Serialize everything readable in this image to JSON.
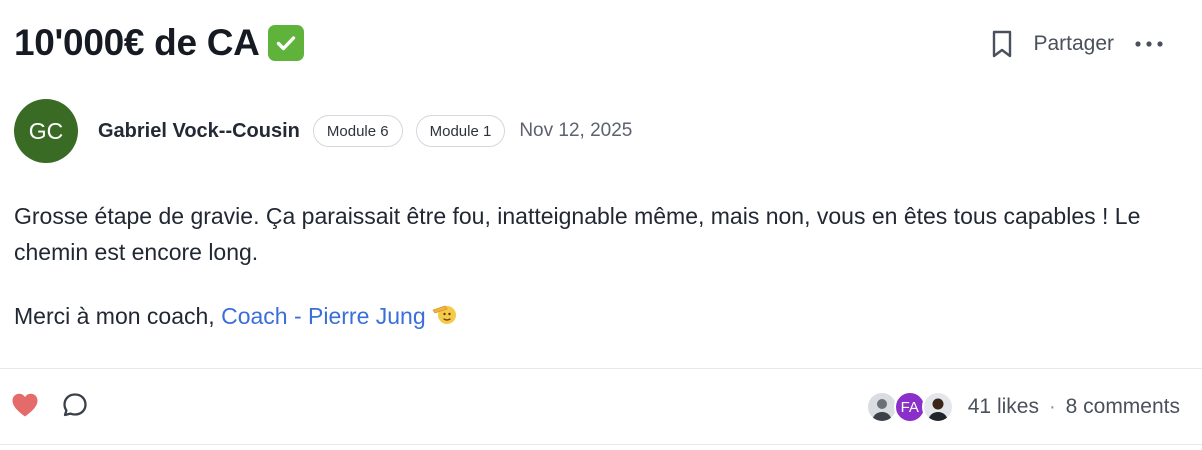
{
  "post": {
    "title": "10'000€ de CA",
    "title_badge_icon": "check-mark-button-icon",
    "share_label": "Partager",
    "author": {
      "initials": "GC",
      "name": "Gabriel Vock--Cousin",
      "avatar_color": "#3a6b25"
    },
    "tags": [
      "Module 6",
      "Module 1"
    ],
    "date": "Nov 12, 2025",
    "body": {
      "paragraph_1": "Grosse étape de gravie. Ça paraissait être fou, inatteignable même, mais non, vous en êtes tous capables ! Le chemin est encore long.",
      "paragraph_2_prefix": "Merci à mon coach,",
      "mention": "Coach - Pierre Jung",
      "emoji_icon": "saluting-face-icon"
    }
  },
  "footer": {
    "liker_initials": "FA",
    "likes": "41 likes",
    "separator": "·",
    "comments": "8 comments",
    "like_color": "#e56a6a"
  },
  "colors": {
    "accent_link": "#3b6fd8",
    "check_badge": "#5fb33a",
    "liker_initials_bg": "#8a2fc9"
  }
}
